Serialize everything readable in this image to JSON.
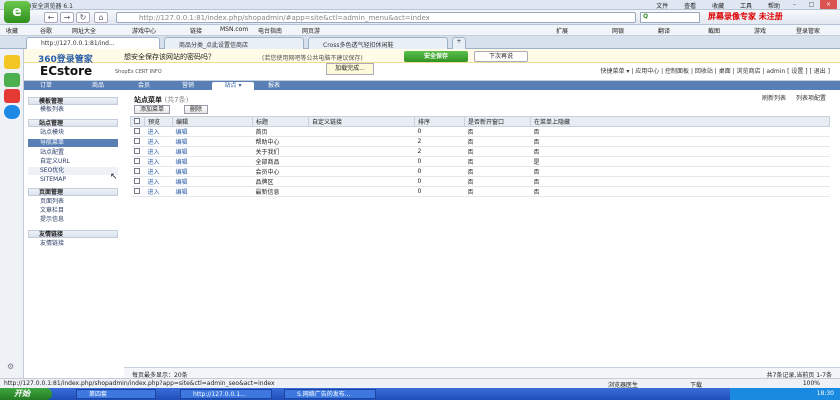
{
  "window": {
    "title": "360安全浏览器 6.1",
    "menu": [
      "文件",
      "查看",
      "收藏",
      "工具",
      "帮助"
    ]
  },
  "nav": {
    "url": "http://127.0.0.1:81/index.php/shopadmin/#app=site&ctl=admin_menu&act=index",
    "promo": "屏幕录像专家 未注册"
  },
  "favorites": [
    "收藏",
    "谷歌",
    "网址大全",
    "游戏中心",
    "链接",
    "MSN.com",
    "电台指南",
    "网页游",
    "扩展",
    "网银",
    "翻译",
    "截图",
    "游戏",
    "登录管家"
  ],
  "tabs": [
    {
      "label": "http://127.0.0.1:81/ind..."
    },
    {
      "label": "商品分类_点此设置信商店"
    },
    {
      "label": "Cross多色透气轻扣休闲鞋"
    }
  ],
  "savebar": {
    "brand": "360登录管家",
    "question": "想安全保存该网站的密码吗？",
    "hint": "(若您使用网吧等公共电脑不建议保存)",
    "save": "安全保存",
    "later": "下次再说",
    "loading": "加载完成..."
  },
  "app": {
    "name": "ECstore",
    "sub": "ShopEx CERT INFO",
    "quickmenu": "快捷菜单 ▾ | 应用中心 | 控制面板 | 回收站 | 桌面 | 浏览商店 | admin [ 设置 ] [ 退出 ]"
  },
  "maintabs": [
    "订单",
    "商品",
    "会员",
    "营销",
    "站点",
    "报表"
  ],
  "leftmenu": {
    "sections": [
      {
        "title": "模板管理",
        "items": [
          "模板列表"
        ]
      },
      {
        "title": "站点管理",
        "items": [
          "站点模块",
          "导航菜单",
          "站点配置",
          "自定义URL",
          "SEO优化",
          "SITEMAP"
        ]
      },
      {
        "title": "页面管理",
        "items": [
          "页面列表",
          "文章栏目",
          "提示信息"
        ]
      },
      {
        "title": "友情链接",
        "items": [
          "友情链接"
        ]
      }
    ]
  },
  "content": {
    "title": "站点菜单",
    "count": "(共7条)",
    "toplinks": [
      "刷新列表",
      "列表项配置"
    ],
    "add_btn": "添加菜单",
    "delete_btn": "删除",
    "columns": [
      "",
      "预览",
      "编辑",
      "标题",
      "自定义链接",
      "排序",
      "是否新开窗口",
      "在菜单上隐藏"
    ],
    "rows": [
      {
        "preview": "进入",
        "edit": "编辑",
        "title": "首页",
        "link": "",
        "order": "0",
        "newwin": "否",
        "hide": "否"
      },
      {
        "preview": "进入",
        "edit": "编辑",
        "title": "帮助中心",
        "link": "",
        "order": "2",
        "newwin": "否",
        "hide": "否"
      },
      {
        "preview": "进入",
        "edit": "编辑",
        "title": "关于我们",
        "link": "",
        "order": "2",
        "newwin": "否",
        "hide": "否"
      },
      {
        "preview": "进入",
        "edit": "编辑",
        "title": "全部商品",
        "link": "",
        "order": "0",
        "newwin": "否",
        "hide": "是"
      },
      {
        "preview": "进入",
        "edit": "编辑",
        "title": "会员中心",
        "link": "",
        "order": "0",
        "newwin": "否",
        "hide": "否"
      },
      {
        "preview": "进入",
        "edit": "编辑",
        "title": "品牌区",
        "link": "",
        "order": "0",
        "newwin": "否",
        "hide": "否"
      },
      {
        "preview": "进入",
        "edit": "编辑",
        "title": "最新信息",
        "link": "",
        "order": "0",
        "newwin": "否",
        "hide": "否"
      }
    ],
    "footer_left": "每页最多显示：20条",
    "footer_right": "共7条记录,当前页 1-7条"
  },
  "status": {
    "url": "http://127.0.0.1:81/index.php/shopadmin/index.php?app=site&ctl=admin_seo&act=index",
    "doctor": "浏览器医生",
    "download": "下载",
    "zoom": "100%"
  },
  "taskbar": {
    "start": "开始",
    "tasks": [
      "第四套",
      "http://127.0.0.1...",
      "S.网络广告的发布..."
    ],
    "time": "18:30"
  },
  "colors": {
    "accent": "#5a7fb5",
    "save": "#2f9322",
    "taskbar": "#1f4fb8"
  }
}
